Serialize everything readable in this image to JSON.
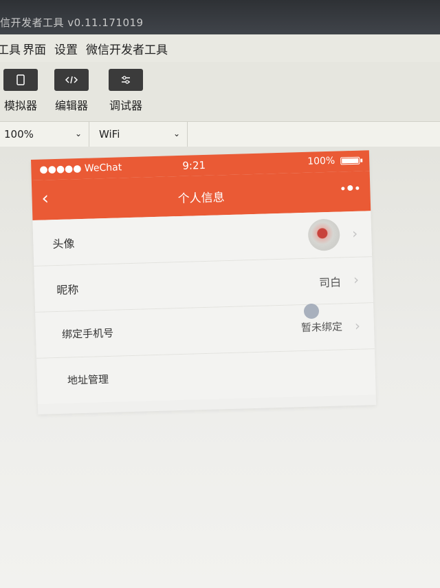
{
  "window": {
    "title": "信开发者工具 v0.11.171019"
  },
  "menu": {
    "items": [
      "工具",
      "界面",
      "设置",
      "微信开发者工具"
    ]
  },
  "toolbar": {
    "simulator_label": "模拟器",
    "editor_label": "编辑器",
    "debugger_label": "调试器",
    "simulator_icon": "phone-icon",
    "editor_icon": "code-icon",
    "debugger_icon": "sliders-icon"
  },
  "settings": {
    "zoom": "100%",
    "network": "WiFi"
  },
  "phone": {
    "status": {
      "carrier": "●●●●● WeChat",
      "time": "9:21",
      "battery": "100%"
    },
    "nav": {
      "back_icon": "chevron-left-icon",
      "title": "个人信息",
      "more_icon": "more-dots-icon"
    },
    "rows": [
      {
        "label": "头像",
        "value": ""
      },
      {
        "label": "昵称",
        "value": "司白"
      },
      {
        "label": "绑定手机号",
        "value": "暂未绑定"
      },
      {
        "label": "地址管理",
        "value": ""
      }
    ]
  },
  "colors": {
    "accent": "#ea5a35",
    "window_dark": "#2e3135",
    "background": "#ecece6"
  }
}
